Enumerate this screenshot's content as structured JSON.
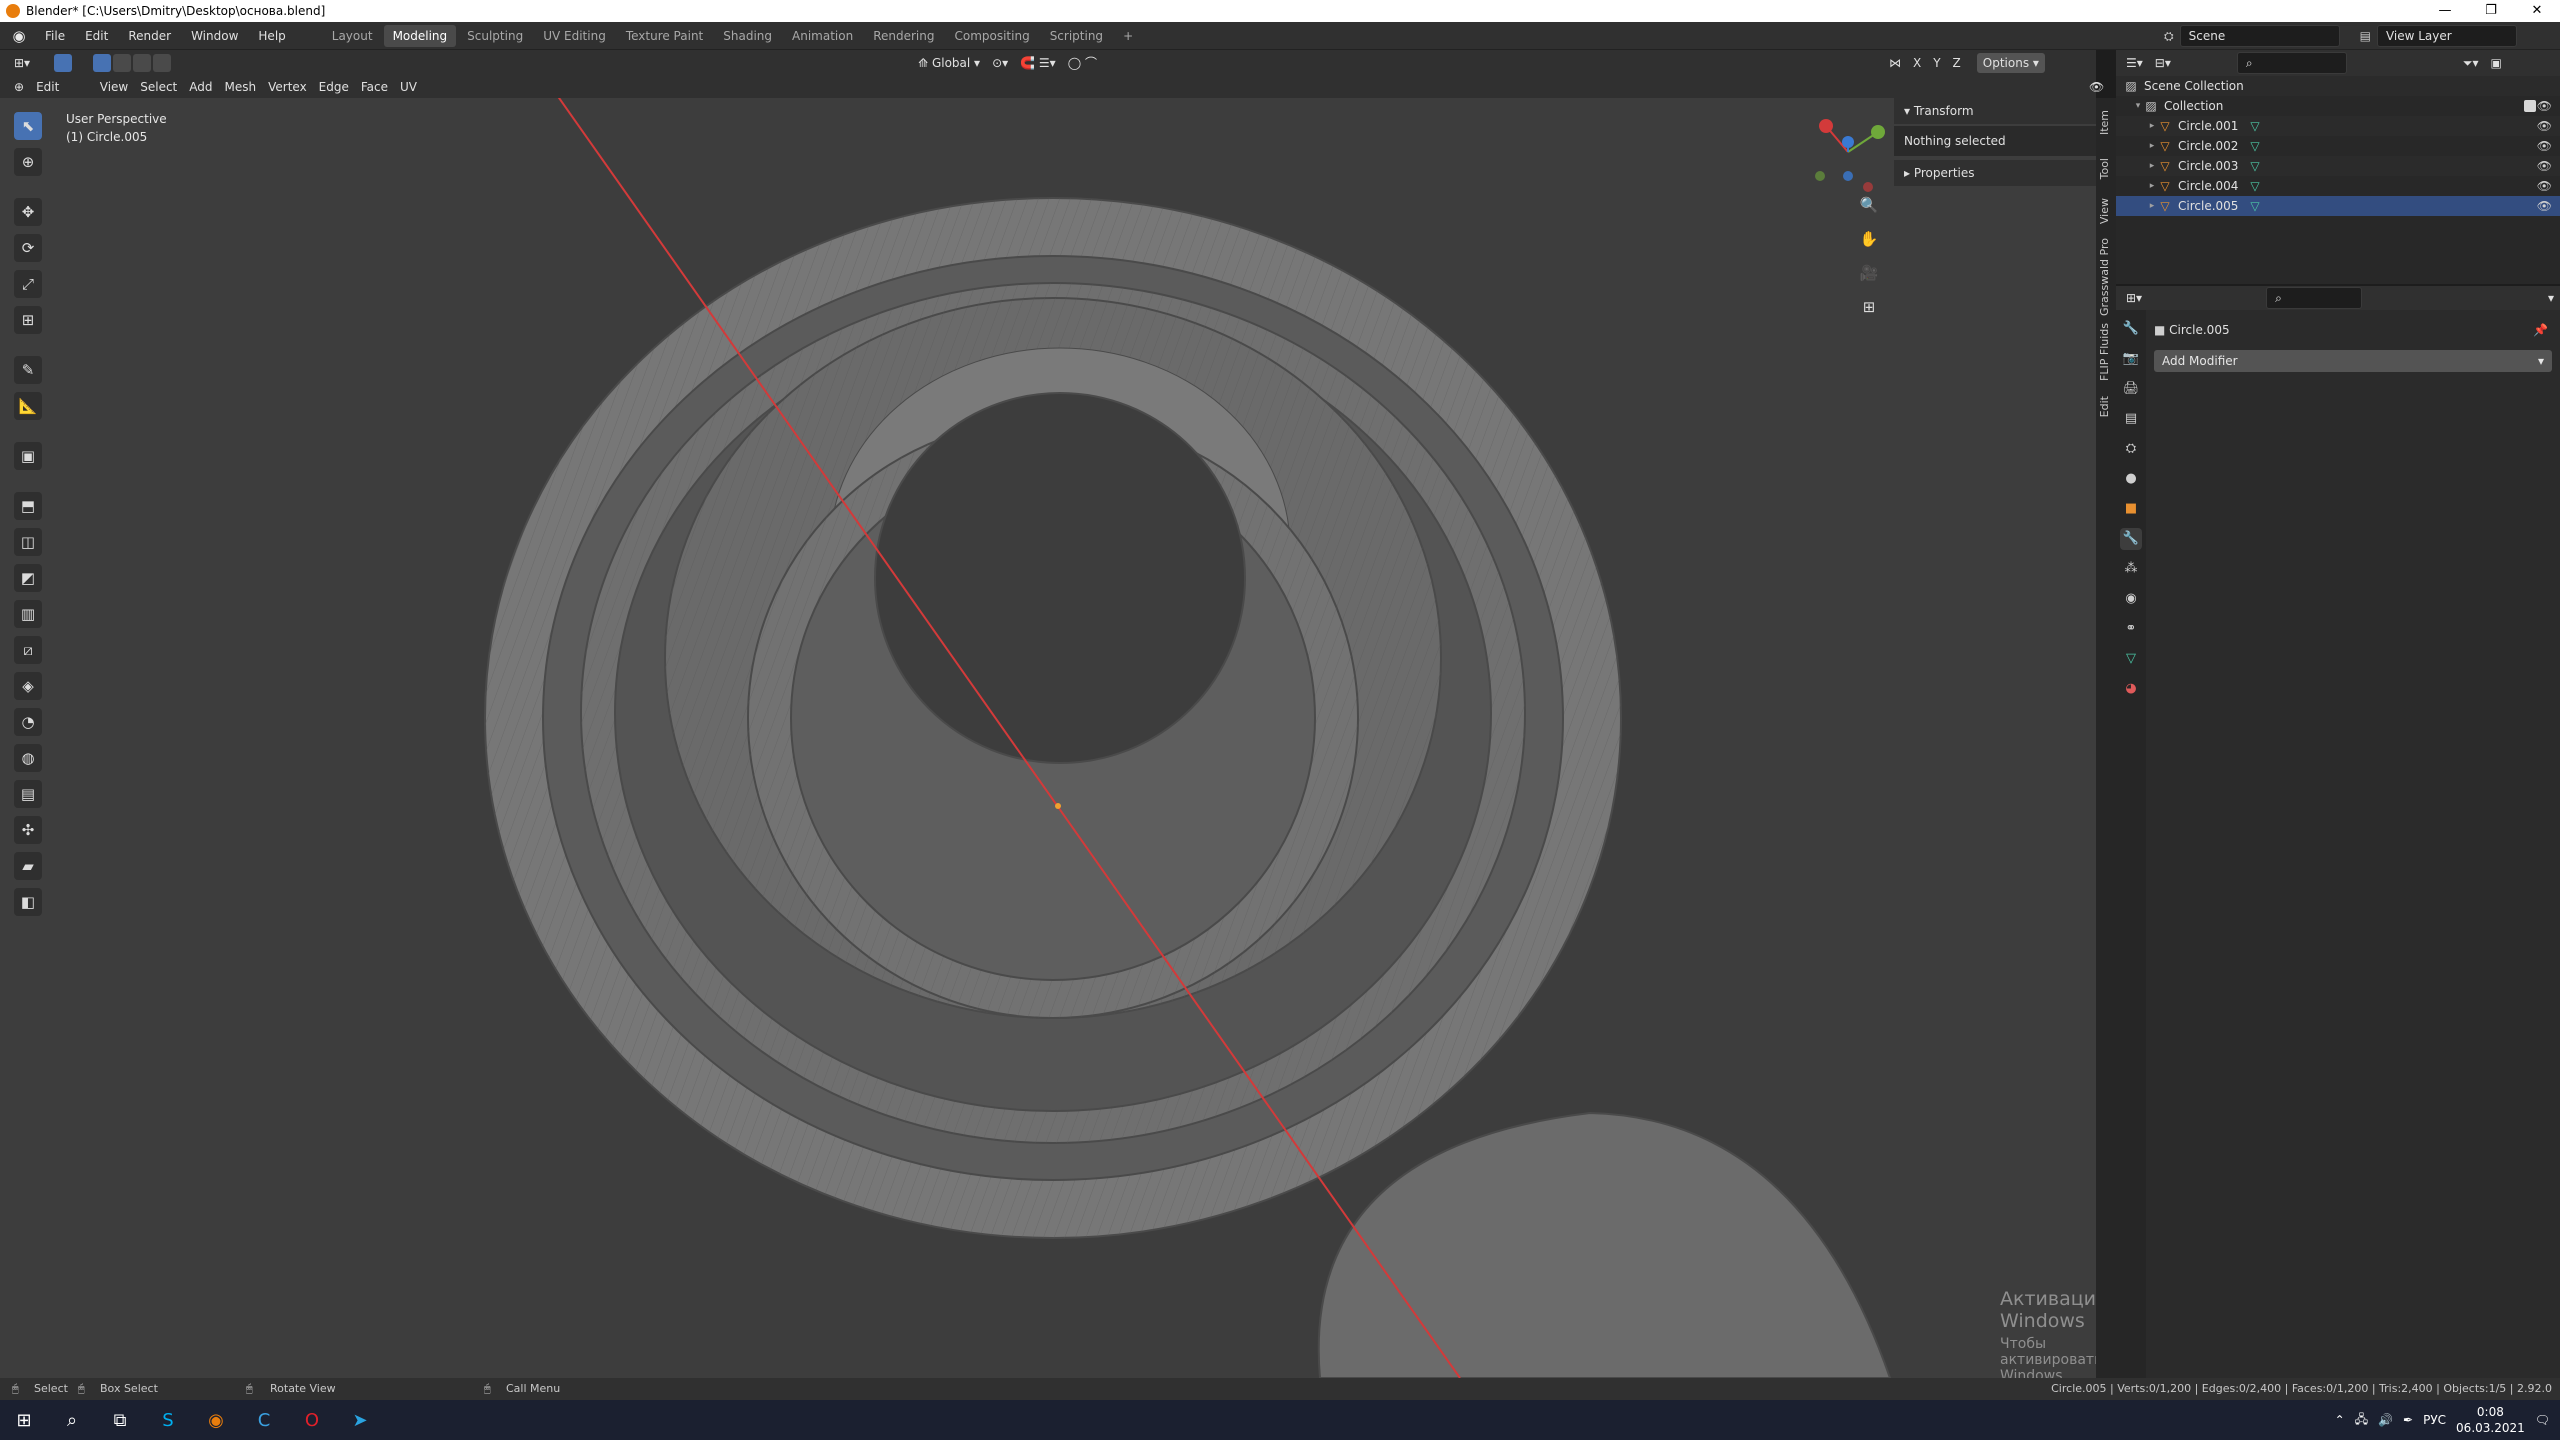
{
  "window": {
    "title": "Blender* [C:\\Users\\Dmitry\\Desktop\\основа.blend]",
    "min": "—",
    "restore": "❐",
    "close": "✕"
  },
  "menu": [
    "File",
    "Edit",
    "Render",
    "Window",
    "Help"
  ],
  "workspaces": [
    "Layout",
    "Modeling",
    "Sculpting",
    "UV Editing",
    "Texture Paint",
    "Shading",
    "Animation",
    "Rendering",
    "Compositing",
    "Scripting"
  ],
  "active_workspace": "Modeling",
  "add_workspace": "+",
  "scene": {
    "label": "Scene",
    "view_layer": "View Layer"
  },
  "header": {
    "transform_orientation": "Global",
    "options": "Options",
    "axes": [
      "X",
      "Y",
      "Z"
    ]
  },
  "vp_header": {
    "mode": "Edit Mode",
    "menus": [
      "View",
      "Select",
      "Add",
      "Mesh",
      "Vertex",
      "Edge",
      "Face",
      "UV"
    ]
  },
  "viewport": {
    "perspective": "User Perspective",
    "object_label": "(1) Circle.005"
  },
  "npanel": {
    "transform": "Transform",
    "nothing_selected": "Nothing selected",
    "properties": "Properties",
    "tabs": [
      "Item",
      "Tool",
      "View",
      "Grasswald Pro",
      "FLIP Fluids",
      "Edit"
    ]
  },
  "outliner": {
    "scene_collection": "Scene Collection",
    "collection": "Collection",
    "objects": [
      "Circle.001",
      "Circle.002",
      "Circle.003",
      "Circle.004",
      "Circle.005"
    ],
    "selected": "Circle.005"
  },
  "properties": {
    "object_name": "Circle.005",
    "add_modifier": "Add Modifier"
  },
  "watermark": {
    "line1": "Активация Windows",
    "line2": "Чтобы активировать Windows, перейдите в раздел \"Параметры\"."
  },
  "statusbar": {
    "select": "Select",
    "box_select": "Box Select",
    "rotate_view": "Rotate View",
    "call_menu": "Call Menu",
    "stats": "Circle.005 | Verts:0/1,200 | Edges:0/2,400 | Faces:0/1,200 | Tris:2,400 | Objects:1/5 | 2.92.0"
  },
  "taskbar": {
    "lang": "РУС",
    "time": "0:08",
    "date": "06.03.2021"
  },
  "colors": {
    "accent": "#4772b3",
    "object_orange": "#e89030",
    "mesh_green": "#4bc8a6",
    "axis_red": "#d33a3a"
  }
}
